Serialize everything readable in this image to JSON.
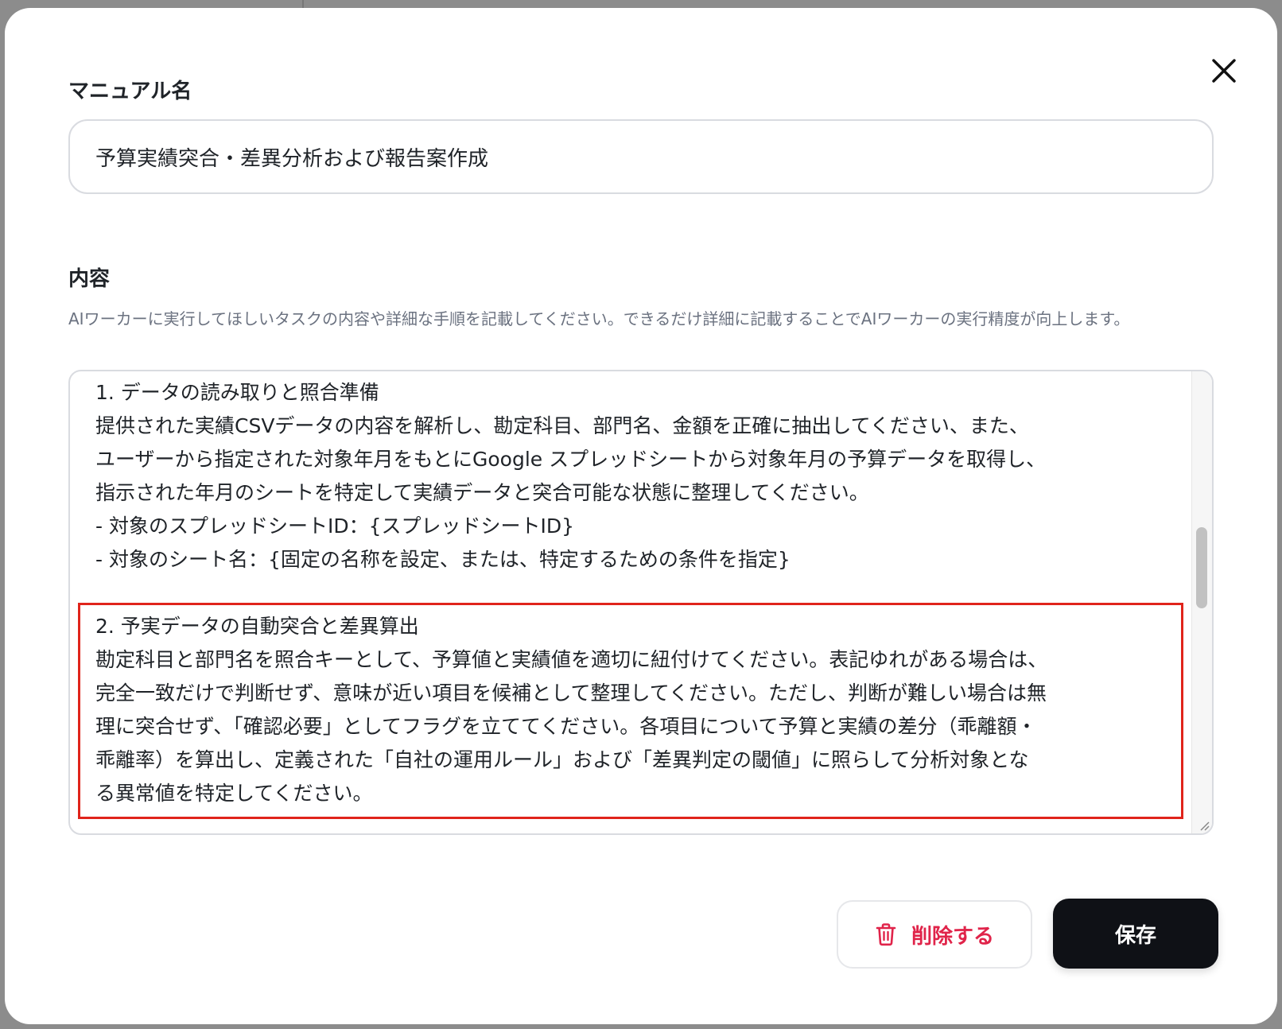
{
  "dialog": {
    "manual_name_label": "マニュアル名",
    "manual_name_value": "予算実績突合・差異分析および報告案作成",
    "content_label": "内容",
    "content_description": "AIワーカーに実行してほしいタスクの内容や詳細な手順を記載してください。できるだけ詳細に記載することでAIワーカーの実行精度が向上します。",
    "content_lines": [
      "1. データの読み取りと照合準備",
      "提供された実績CSVデータの内容を解析し、勘定科目、部門名、金額を正確に抽出してください、また、",
      "ユーザーから指定された対象年月をもとにGoogle スプレッドシートから対象年月の予算データを取得し、",
      "指示された年月のシートを特定して実績データと突合可能な状態に整理してください。",
      "- 対象のスプレッドシートID：{スプレッドシートID}",
      "- 対象のシート名：{固定の名称を設定、または、特定するための条件を指定}",
      "",
      "2. 予実データの自動突合と差異算出",
      "勘定科目と部門名を照合キーとして、予算値と実績値を適切に紐付けてください。表記ゆれがある場合は、",
      "完全一致だけで判断せず、意味が近い項目を候補として整理してください。ただし、判断が難しい場合は無",
      "理に突合せず、「確認必要」としてフラグを立ててください。各項目について予算と実績の差分（乖離額・",
      "乖離率）を算出し、定義された「自社の運用ルール」および「差異判定の閾値」に照らして分析対象とな",
      "る異常値を特定してください。"
    ],
    "delete_label": "削除する",
    "save_label": "保存"
  },
  "colors": {
    "highlight_border": "#e0241b",
    "delete_text": "#e0244a",
    "save_bg": "#0f1116"
  },
  "icons": {
    "close": "close-icon",
    "delete": "trash-icon"
  }
}
